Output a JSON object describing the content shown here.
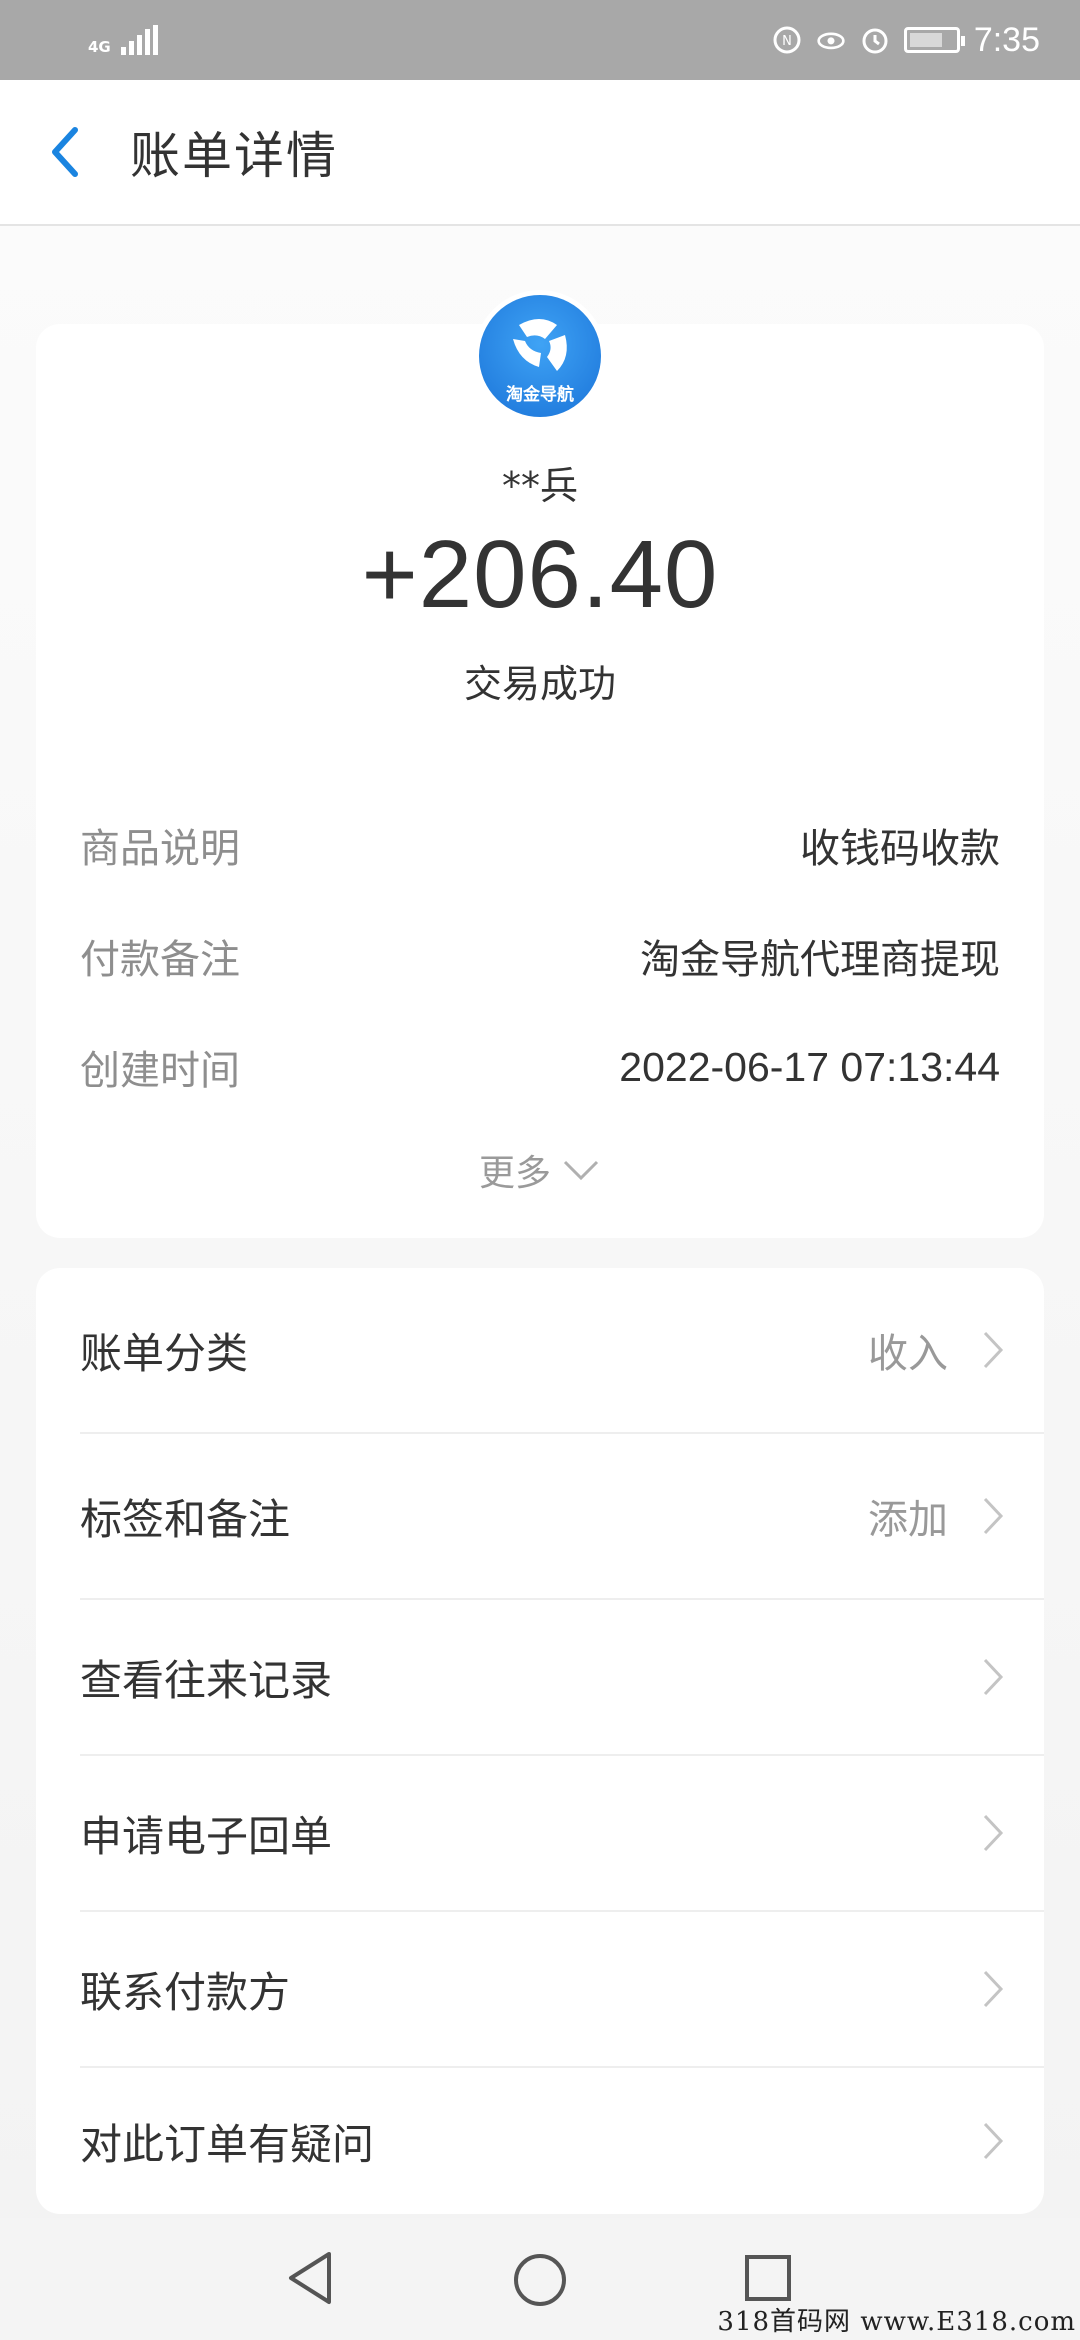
{
  "status_bar": {
    "network": "4G",
    "time": "7:35"
  },
  "header": {
    "title": "账单详情"
  },
  "summary": {
    "logo_caption": "淘金导航",
    "payer_name": "**兵",
    "amount": "+206.40",
    "status": "交易成功"
  },
  "details": [
    {
      "label": "商品说明",
      "value": "收钱码收款"
    },
    {
      "label": "付款备注",
      "value": "淘金导航代理商提现"
    },
    {
      "label": "创建时间",
      "value": "2022-06-17 07:13:44"
    }
  ],
  "more_label": "更多",
  "menu": [
    {
      "label": "账单分类",
      "value": "收入"
    },
    {
      "label": "标签和备注",
      "value": "添加"
    },
    {
      "label": "查看往来记录",
      "value": ""
    },
    {
      "label": "申请电子回单",
      "value": ""
    },
    {
      "label": "联系付款方",
      "value": ""
    },
    {
      "label": "对此订单有疑问",
      "value": ""
    }
  ],
  "watermark": "318首码网 www.E318.com",
  "colors": {
    "accent": "#1a73d8",
    "status_bar": "#a8a8a8",
    "text_primary": "#333333",
    "text_secondary": "#8e8e8e"
  },
  "icons": [
    "back-arrow-icon",
    "chevron-down-icon",
    "chevron-right-icon",
    "nav-back-icon",
    "nav-home-icon",
    "nav-recents-icon"
  ]
}
